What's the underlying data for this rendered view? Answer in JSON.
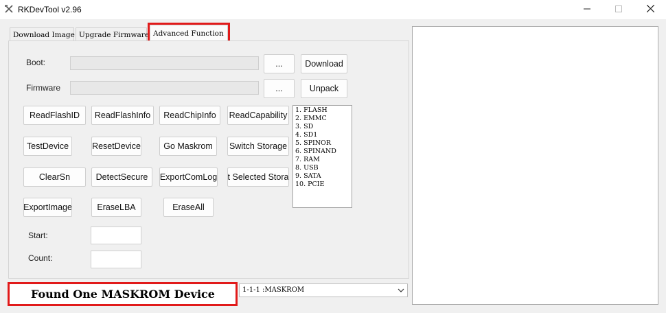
{
  "window": {
    "title": "RKDevTool v2.96"
  },
  "tabs": [
    {
      "label": "Download Image"
    },
    {
      "label": "Upgrade Firmware"
    },
    {
      "label": "Advanced Function"
    }
  ],
  "boot": {
    "label": "Boot:",
    "path": "",
    "browse_label": "...",
    "action_label": "Download"
  },
  "firmware": {
    "label": "Firmware",
    "path": "",
    "browse_label": "...",
    "action_label": "Unpack"
  },
  "buttons": {
    "read_flash_id": "ReadFlashID",
    "read_flash_info": "ReadFlashInfo",
    "read_chip_info": "ReadChipInfo",
    "read_capability": "ReadCapability",
    "test_device": "TestDevice",
    "reset_device": "ResetDevice",
    "go_maskrom": "Go Maskrom",
    "switch_storage": "Switch Storage",
    "clear_sn": "ClearSn",
    "detect_secure": "DetectSecure",
    "export_com_log": "ExportComLog",
    "selected_storage": "t Selected Stora",
    "export_image": "ExportImage",
    "erase_lba": "EraseLBA",
    "erase_all": "EraseAll"
  },
  "storage_list": [
    "1.  FLASH",
    "2.  EMMC",
    "3.  SD",
    "4.  SD1",
    "5.  SPINOR",
    "6.  SPINAND",
    "7.  RAM",
    "8.  USB",
    "9.  SATA",
    "10.  PCIE"
  ],
  "start": {
    "label": "Start:",
    "value": ""
  },
  "count": {
    "label": "Count:",
    "value": ""
  },
  "status": {
    "text": "Found One MASKROM Device"
  },
  "device_select": {
    "value": "1-1-1 :MASKROM"
  },
  "log": {
    "text": ""
  },
  "colors": {
    "highlight": "#e11a1a",
    "window_bg": "#f0f0f0"
  }
}
